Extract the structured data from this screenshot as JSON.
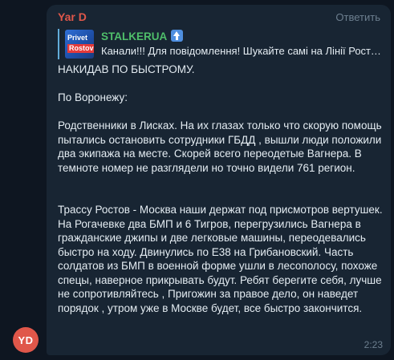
{
  "message": {
    "sender": "Yar D",
    "avatar_initials": "YD",
    "reply_action": "Ответить",
    "time": "2:23",
    "forwarded": {
      "thumb_line1": "Privet",
      "thumb_line2": "Rostov",
      "channel": "STALKERUA",
      "channel_emoji": "up-arrow-icon",
      "snippet": "Канали!!! Для повідомлення!  Шукайте самі на Лінії Ростов — Москва"
    },
    "paragraphs": [
      "НАКИДАВ ПО БЫСТРОМУ.",
      "По Воронежу:",
      "Родственники в Лисках. На их глазах только что скорую помощь пытались остановить сотрудники ГБДД , вышли люди положили два экипажа на месте. Скорей всего переодетые Вагнера. В темноте номер не разглядели но точно видели 761 регион.",
      "Трассу Ростов - Москва наши держат под присмотров вертушек. На Рогачевке два БМП и 6 Тигров, перегрузились Вагнера в гражданские джипы и две легковые машины, переодевались быстро на ходу. Двинулись по Е38 на Грибановский. Часть солдатов из БМП в военной форме ушли в лесополосу, похоже спецы, наверное прикрывать будут. Ребят берегите себя, лучше не сопротивляйтесь , Пригожин за правое дело, он наведет порядок , утром уже в Москве будет, все быстро закончится."
    ]
  },
  "colors": {
    "background": "#0e1621",
    "bubble": "#182533",
    "sender": "#e0574a",
    "channel": "#4fbf6a",
    "accent_bar": "#62acd9",
    "text": "#e4ecf2",
    "muted": "#6d7f8f"
  }
}
